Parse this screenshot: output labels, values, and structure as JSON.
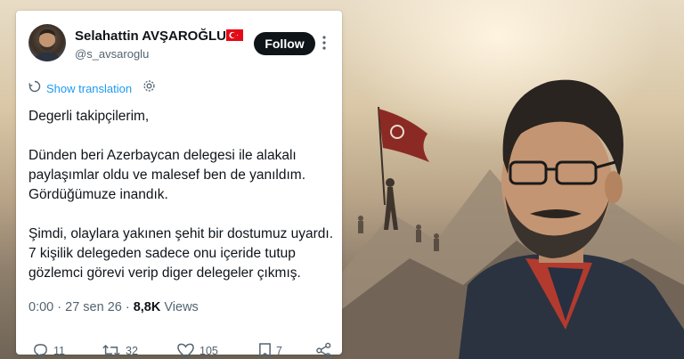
{
  "tweet": {
    "display_name": "Selahattin AVŞAROĞLU",
    "handle": "@s_avsaroglu",
    "follow_label": "Follow",
    "translate_label": "Show translation",
    "paragraphs": [
      "Degerli takipçilerim,",
      "Dünden beri Azerbaycan delegesi ile alakalı paylaşımlar oldu ve malesef ben de yanıldım. Gördüğümuze inandık.",
      "Şimdi, olaylara yakınen şehit bir dostumuz uyardı. 7 kişilik delegeden sadece onu içeride tutup gözlemci görevi verip diger delegeler çıkmış."
    ],
    "time": "0:00",
    "date": "27 sen 26",
    "views_count": "8,8K",
    "views_label": "Views",
    "replies": "11",
    "retweets": "32",
    "likes": "105",
    "bookmarks": "7"
  },
  "icons": {
    "flag": "turkey-flag-icon",
    "more": "more-icon",
    "translate": "translate-icon",
    "settings": "gear-icon",
    "reply": "reply-icon",
    "retweet": "retweet-icon",
    "like": "heart-icon",
    "bookmark": "bookmark-icon",
    "share": "share-icon"
  },
  "colors": {
    "accent": "#1d9bf0",
    "text": "#0f1419",
    "muted": "#536471",
    "follow_bg": "#0f1419",
    "flag_red": "#e30a17"
  }
}
